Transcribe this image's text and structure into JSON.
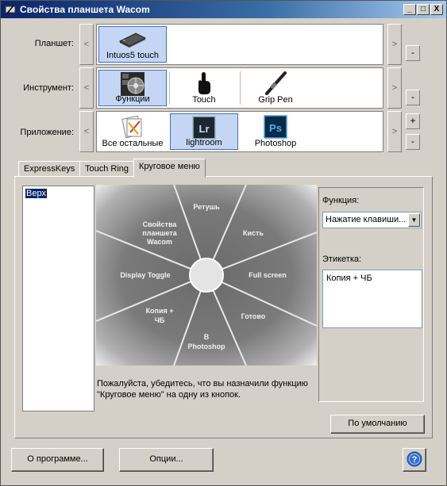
{
  "window": {
    "title": "Свойства планшета Wacom",
    "controls": {
      "minimize": "_",
      "maximize": "□",
      "close": "X"
    }
  },
  "rows": {
    "tablet": {
      "label": "Планшет:",
      "items": [
        {
          "label": "Intuos5 touch",
          "icon": "tablet-icon",
          "selected": true
        }
      ]
    },
    "tool": {
      "label": "Инструмент:",
      "items": [
        {
          "label": "Функции",
          "icon": "functions-icon",
          "selected": true
        },
        {
          "label": "Touch",
          "icon": "touch-hand-icon",
          "selected": false
        },
        {
          "label": "Grip Pen",
          "icon": "pen-icon",
          "selected": false
        }
      ]
    },
    "application": {
      "label": "Приложение:",
      "items": [
        {
          "label": "Все остальные",
          "icon": "all-apps-icon",
          "selected": false
        },
        {
          "label": "lightroom",
          "icon": "lightroom-icon",
          "selected": true
        },
        {
          "label": "Photoshop",
          "icon": "photoshop-icon",
          "selected": false
        }
      ]
    },
    "arrows": {
      "left": "<",
      "right": ">"
    },
    "buttons": {
      "add": "+",
      "remove": "-"
    }
  },
  "app_icons": {
    "lightroom": "Lr",
    "photoshop": "Ps"
  },
  "tabs": [
    {
      "label": "ExpressKeys",
      "active": false
    },
    {
      "label": "Touch Ring",
      "active": false
    },
    {
      "label": "Круговое меню",
      "active": true
    }
  ],
  "menu_list": {
    "items": [
      "Верх"
    ]
  },
  "radial_menu": {
    "segments": [
      "Ретушь",
      "Кисть",
      "Full screen",
      "Готово",
      "В Photoshop",
      "Копия + ЧБ",
      "Display Toggle",
      "Свойства планшета Wacom"
    ]
  },
  "help_text": "Пожалуйста, убедитесь, что вы назначили функцию \"Круговое меню\" на одну из кнопок.",
  "function": {
    "label": "Функция:",
    "value": "Нажатие клавиши..."
  },
  "caption": {
    "label": "Этикетка:",
    "value": "Копия + ЧБ"
  },
  "buttons": {
    "default": "По умолчанию",
    "about": "О программе...",
    "options": "Опции...",
    "help": "?"
  },
  "colors": {
    "titlebar": "#0a246a",
    "selection": "#c5d6f4",
    "face": "#d4d0c8"
  }
}
